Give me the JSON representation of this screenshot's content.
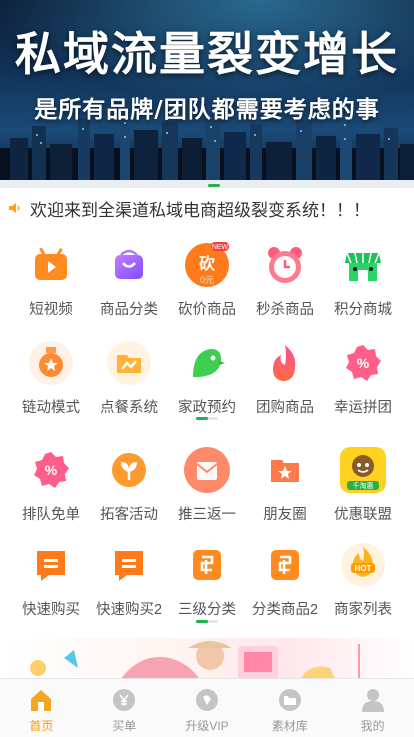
{
  "banner": {
    "title": "私域流量裂变增长",
    "subtitle": "是所有品牌/团队都需要考虑的事"
  },
  "notice": {
    "text": "欢迎来到全渠道私域电商超级裂变系统！！！"
  },
  "grid": [
    {
      "label": "短视频",
      "icon": "tv-icon"
    },
    {
      "label": "商品分类",
      "icon": "shopping-bag-icon"
    },
    {
      "label": "砍价商品",
      "icon": "bargain-badge-icon",
      "badge_text": "砍",
      "badge_new": "NEW",
      "badge_price": "0元"
    },
    {
      "label": "秒杀商品",
      "icon": "alarm-clock-icon"
    },
    {
      "label": "积分商城",
      "icon": "store-icon"
    },
    {
      "label": "链动模式",
      "icon": "medal-icon"
    },
    {
      "label": "点餐系统",
      "icon": "folder-chart-icon"
    },
    {
      "label": "家政预约",
      "icon": "bird-icon"
    },
    {
      "label": "团购商品",
      "icon": "flame-icon"
    },
    {
      "label": "幸运拼团",
      "icon": "percent-badge-icon"
    },
    {
      "label": "排队免单",
      "icon": "percent-badge-icon"
    },
    {
      "label": "拓客活动",
      "icon": "sprout-icon"
    },
    {
      "label": "推三返一",
      "icon": "envelope-icon"
    },
    {
      "label": "朋友圈",
      "icon": "star-folder-icon"
    },
    {
      "label": "优惠联盟",
      "icon": "mascot-icon",
      "badge_text": "千淘惠"
    },
    {
      "label": "快速购买",
      "icon": "chat-list-icon"
    },
    {
      "label": "快速购买2",
      "icon": "chat-list-icon"
    },
    {
      "label": "三级分类",
      "icon": "coupon-icon"
    },
    {
      "label": "分类商品2",
      "icon": "coupon-icon"
    },
    {
      "label": "商家列表",
      "icon": "hot-badge-icon",
      "badge_text": "HOT"
    }
  ],
  "tabbar": [
    {
      "label": "首页",
      "icon": "home-icon",
      "active": true
    },
    {
      "label": "买单",
      "icon": "yen-icon",
      "active": false
    },
    {
      "label": "升级VIP",
      "icon": "diamond-icon",
      "active": false
    },
    {
      "label": "素材库",
      "icon": "folder-icon",
      "active": false
    },
    {
      "label": "我的",
      "icon": "user-icon",
      "active": false
    }
  ],
  "colors": {
    "accent_green": "#22b14c",
    "tab_active": "#f39c12",
    "orange": "#ff7a1a",
    "text": "#555555"
  }
}
